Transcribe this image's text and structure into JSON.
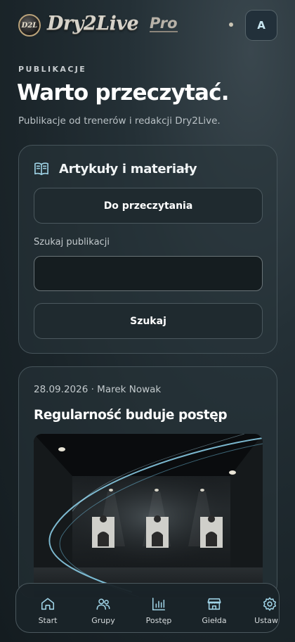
{
  "header": {
    "logo_badge": "D2L",
    "logo_text": "Dry2Live",
    "logo_pro": "Pro",
    "avatar_initial": "A"
  },
  "hero": {
    "eyebrow": "PUBLIKACJE",
    "title": "Warto przeczytać.",
    "subtitle": "Publikacje od trenerów i redakcji Dry2Live."
  },
  "panel": {
    "title": "Artykuły i materiały",
    "icon": "book-open-icon",
    "read_button": "Do przeczytania",
    "search_label": "Szukaj publikacji",
    "search_value": "",
    "search_placeholder": "",
    "search_button": "Szukaj"
  },
  "articles": [
    {
      "meta": "28.09.2026 · Marek Nowak",
      "title": "Regularność buduje postęp"
    }
  ],
  "nav": {
    "items": [
      {
        "label": "Start",
        "icon": "home-icon"
      },
      {
        "label": "Grupy",
        "icon": "users-icon"
      },
      {
        "label": "Postęp",
        "icon": "bar-chart-icon"
      },
      {
        "label": "Giełda",
        "icon": "store-icon"
      },
      {
        "label": "Ustawie",
        "icon": "settings-icon"
      }
    ]
  },
  "colors": {
    "background": "#1b252a",
    "card_border": "#46545a",
    "avatar_text": "#c8e6f0",
    "icon_accent": "#9fd3e6"
  }
}
